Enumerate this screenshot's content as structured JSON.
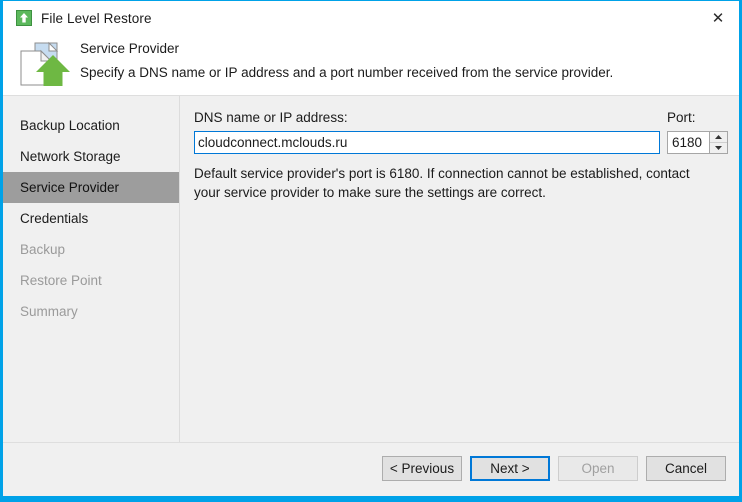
{
  "window": {
    "title": "File Level Restore",
    "title_icon": "green-upload-arrow-icon",
    "close_glyph": "✕",
    "accent_color": "#00a2e8"
  },
  "header": {
    "icon": "file-restore-icon",
    "title": "Service Provider",
    "subtitle": "Specify a DNS name or IP address and a port number received from the service provider."
  },
  "sidebar": {
    "items": [
      {
        "label": "Backup Location",
        "state": "normal"
      },
      {
        "label": "Network Storage",
        "state": "normal"
      },
      {
        "label": "Service Provider",
        "state": "selected"
      },
      {
        "label": "Credentials",
        "state": "normal"
      },
      {
        "label": "Backup",
        "state": "disabled"
      },
      {
        "label": "Restore Point",
        "state": "disabled"
      },
      {
        "label": "Summary",
        "state": "disabled"
      }
    ],
    "selection_color": "#9d9d9d"
  },
  "main": {
    "dns_label": "DNS name or IP address:",
    "dns_value": "cloudconnect.mclouds.ru",
    "dns_placeholder": "",
    "port_label": "Port:",
    "port_value": "6180",
    "spinner_up_icon": "spinner-up-arrow-icon",
    "spinner_down_icon": "spinner-down-arrow-icon",
    "hint": "Default service provider's port is 6180. If connection cannot be established, contact your service provider to make sure the settings are correct."
  },
  "footer": {
    "buttons": [
      {
        "label": "< Previous",
        "state": "normal"
      },
      {
        "label": "Next >",
        "state": "default"
      },
      {
        "label": "Open",
        "state": "disabled"
      },
      {
        "label": "Cancel",
        "state": "normal"
      }
    ]
  }
}
